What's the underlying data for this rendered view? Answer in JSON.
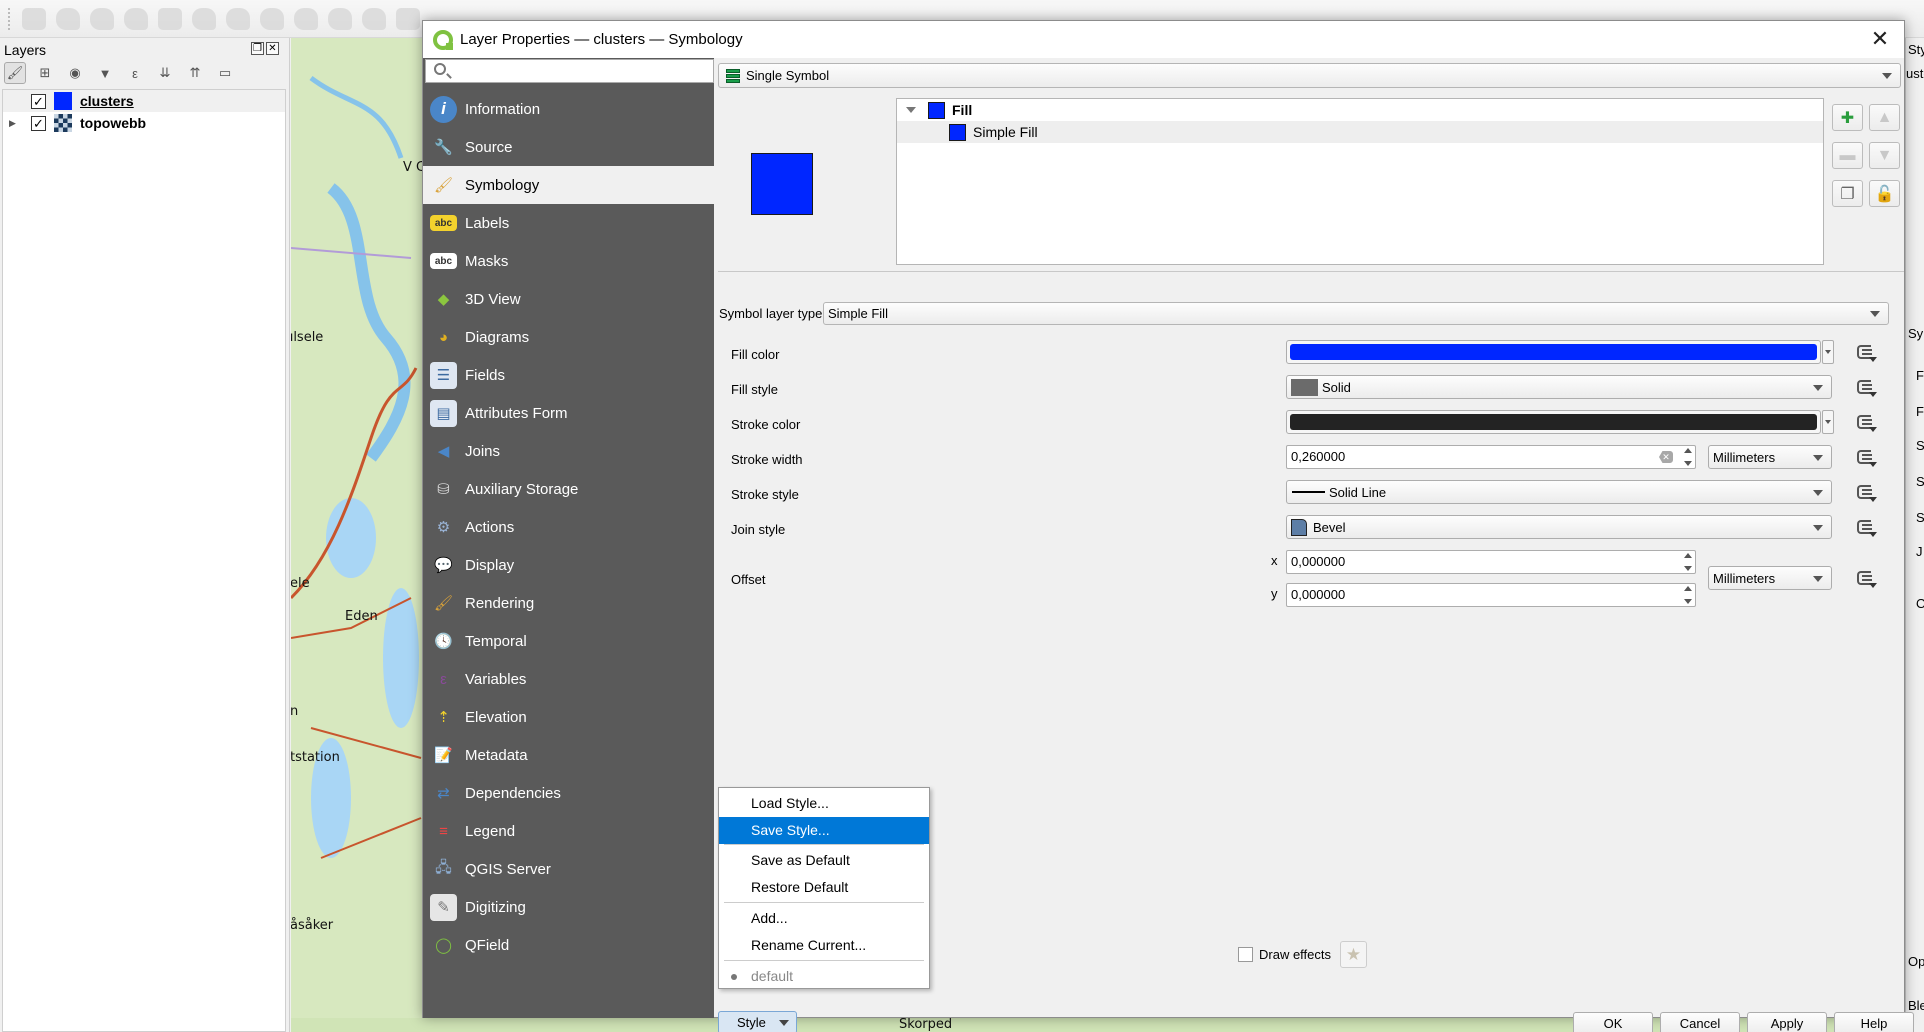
{
  "toolbar": {
    "font_size_value": "12",
    "font_unit": "px"
  },
  "layers_panel": {
    "title": "Layers",
    "layers": [
      {
        "name": "clusters",
        "checked": true,
        "selected": true,
        "symbol_color": "#0026ff"
      },
      {
        "name": "topowebb",
        "checked": true,
        "selected": false
      }
    ]
  },
  "map": {
    "labels": [
      "Gulsele",
      "Eden",
      "ele",
      "n",
      "tstation",
      "åsåker",
      "Skorped",
      "V C"
    ]
  },
  "right_dock": {
    "texts": [
      "Sty",
      "uste",
      "Sy",
      "F",
      "F",
      "S",
      "S",
      "S",
      "J",
      "O",
      "Op",
      "Ble"
    ]
  },
  "dialog": {
    "title": "Layer Properties — clusters — Symbology",
    "close_glyph": "✕",
    "search_placeholder": "",
    "sidebar": {
      "items": [
        {
          "label": "Information",
          "icon": "info-icon"
        },
        {
          "label": "Source",
          "icon": "source-wrench-icon"
        },
        {
          "label": "Symbology",
          "icon": "paintbrush-icon",
          "active": true
        },
        {
          "label": "Labels",
          "icon": "labels-abc-icon"
        },
        {
          "label": "Masks",
          "icon": "masks-abc-icon"
        },
        {
          "label": "3D View",
          "icon": "cube-icon"
        },
        {
          "label": "Diagrams",
          "icon": "diagrams-icon"
        },
        {
          "label": "Fields",
          "icon": "fields-icon"
        },
        {
          "label": "Attributes Form",
          "icon": "form-icon"
        },
        {
          "label": "Joins",
          "icon": "joins-icon"
        },
        {
          "label": "Auxiliary Storage",
          "icon": "database-icon"
        },
        {
          "label": "Actions",
          "icon": "actions-gear-icon"
        },
        {
          "label": "Display",
          "icon": "speech-bubble-icon"
        },
        {
          "label": "Rendering",
          "icon": "brush-icon"
        },
        {
          "label": "Temporal",
          "icon": "clock-icon"
        },
        {
          "label": "Variables",
          "icon": "epsilon-icon"
        },
        {
          "label": "Elevation",
          "icon": "elevation-icon"
        },
        {
          "label": "Metadata",
          "icon": "metadata-icon"
        },
        {
          "label": "Dependencies",
          "icon": "dependencies-icon"
        },
        {
          "label": "Legend",
          "icon": "legend-icon"
        },
        {
          "label": "QGIS Server",
          "icon": "server-icon"
        },
        {
          "label": "Digitizing",
          "icon": "digitizing-icon"
        },
        {
          "label": "QField",
          "icon": "qfield-icon"
        }
      ]
    },
    "symbology": {
      "renderer": "Single Symbol",
      "symbol_tree": [
        {
          "label": "Fill",
          "bold": true
        },
        {
          "label": "Simple Fill",
          "bold": false
        }
      ],
      "symbol_layer_type_label": "Symbol layer type",
      "symbol_layer_type": "Simple Fill",
      "properties": {
        "fill_color": {
          "label": "Fill color",
          "value": "#0026ff"
        },
        "fill_style": {
          "label": "Fill style",
          "value": "Solid",
          "swatch": "#6b6b6b"
        },
        "stroke_color": {
          "label": "Stroke color",
          "value": "#232323"
        },
        "stroke_width": {
          "label": "Stroke width",
          "value": "0,260000",
          "unit": "Millimeters"
        },
        "stroke_style": {
          "label": "Stroke style",
          "value": "Solid Line"
        },
        "join_style": {
          "label": "Join style",
          "value": "Bevel"
        },
        "offset": {
          "label": "Offset",
          "x_label": "x",
          "x": "0,000000",
          "y_label": "y",
          "y": "0,000000",
          "unit": "Millimeters"
        }
      },
      "draw_effects_label": "Draw effects",
      "draw_effects_checked": false
    },
    "style_button": "Style",
    "style_menu": {
      "items": [
        {
          "label": "Load Style..."
        },
        {
          "label": "Save Style...",
          "highlighted": true
        },
        {
          "label": "Save as Default"
        },
        {
          "label": "Restore Default"
        },
        {
          "label": "Add..."
        },
        {
          "label": "Rename Current..."
        },
        {
          "label": "default",
          "current": true
        }
      ]
    },
    "buttons": {
      "ok": "OK",
      "cancel": "Cancel",
      "apply": "Apply",
      "help": "Help"
    }
  }
}
